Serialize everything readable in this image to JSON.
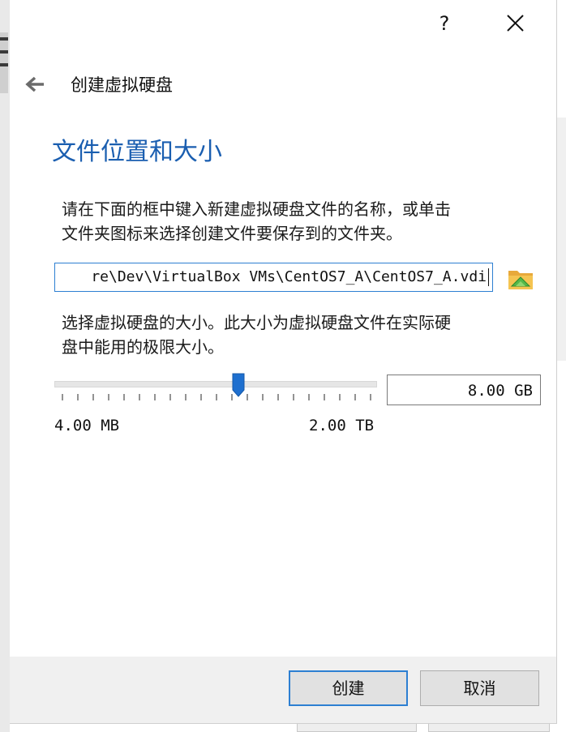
{
  "title_bar": {
    "help_label": "?",
    "close_icon": "close-icon"
  },
  "header": {
    "back_icon": "arrow-left-icon",
    "title": "创建虚拟硬盘"
  },
  "page": {
    "title": "文件位置和大小",
    "location_instructions_line1": "请在下面的框中键入新建虚拟硬盘文件的名称，或单击",
    "location_instructions_line2": "文件夹图标来选择创建文件要保存到的文件夹。",
    "file_path_value": "re\\Dev\\VirtualBox VMs\\CentOS7_A\\CentOS7_A.vdi",
    "folder_icon": "folder-icon",
    "size_instructions_line1": "选择虚拟硬盘的大小。此大小为虚拟硬盘文件在实际硬",
    "size_instructions_line2": "盘中能用的极限大小。",
    "size_value": "8.00 GB",
    "slider_min_label": "4.00 MB",
    "slider_max_label": "2.00 TB",
    "slider_fraction": 0.57
  },
  "footer": {
    "create_label": "创建",
    "cancel_label": "取消"
  },
  "colors": {
    "accent": "#1a5eb0",
    "focus_border": "#2d7fd2",
    "slider_handle": "#1e6fcf"
  }
}
